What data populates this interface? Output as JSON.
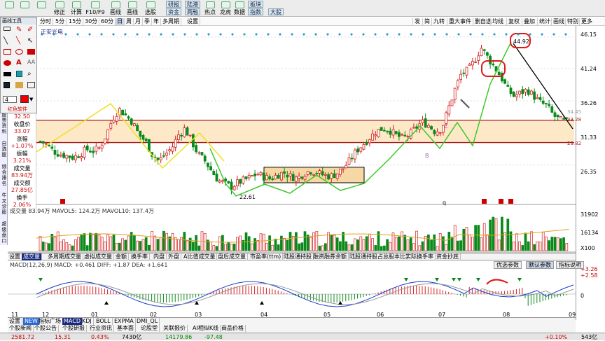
{
  "toolbar": {
    "buttons": [
      "",
      "",
      "",
      "修正",
      "计算",
      "F10/F9",
      "画线",
      "画线",
      "选股",
      "",
      "",
      ""
    ],
    "panel_buttons": [
      [
        "研报",
        "陆港"
      ],
      [
        "资金",
        "两融"
      ],
      [
        "热点",
        "龙虎"
      ],
      [
        "数据"
      ],
      [
        "板块",
        "指数"
      ],
      [
        "大股"
      ]
    ]
  },
  "periods": [
    "分时",
    "5分",
    "15分",
    "30分",
    "60分",
    "日",
    "周",
    "月",
    "季",
    "年",
    "多周期",
    "设置"
  ],
  "active_period": "日",
  "right_tools": [
    "发",
    "简",
    "九转",
    "重大事件",
    "删自选",
    "均线",
    "复权",
    "叠加",
    "统计",
    "画线",
    "特别",
    "更多"
  ],
  "drawing_panel": {
    "title": "画线工具",
    "width_value": "4",
    "red_label": "红色软件"
  },
  "stock_name": "正安光电",
  "left_info": {
    "top_value": "32.50",
    "close_label": "收盘价",
    "close": "33.07",
    "change_label": "涨幅",
    "change": "+1.07%",
    "amp_label": "振幅",
    "amp": "3.21%",
    "vol_label": "成交量",
    "vol": "83.94万",
    "amount_label": "成交额",
    "amount": "27.85亿",
    "turn_label": "换手",
    "turn": "2.06%"
  },
  "side_tabs": [
    "股票资料",
    "自选股",
    "综合排名",
    "牛叉诊股",
    "超级盘口"
  ],
  "price_axis": [
    "46.15",
    "41.24",
    "36.26",
    "31.33",
    "26.35"
  ],
  "volume_axis": [
    "31902",
    "16134",
    "X100"
  ],
  "macd_axis": [
    "+3.26",
    "+2.58",
    "0"
  ],
  "price_levels": {
    "upper": "33.28",
    "lower": "29.82",
    "mid": "34.45"
  },
  "annotations": {
    "high": "44.92",
    "low": "22.61",
    "letter_c": "C",
    "letter_b": "B",
    "letter_q": "q"
  },
  "volume_legend": "成交量 83.94万  MAVOL5: 124.2万  MAVOL10: 137.4万",
  "macd_legend": "MACD(12,26,9)  MACD: +0.461  DIFF: +1.87  DEA: +1.641",
  "chart_tabs": [
    "设置",
    "成交量",
    "多周期成交量",
    "虚拟成交量",
    "金额",
    "换手率",
    "内盘",
    "外盘",
    "A比值成交量",
    "盘后成交量",
    "市盈率(ttm)",
    "陆股通持股",
    "融资融券余额",
    "陆股通持股占总股本比",
    "实际换手率",
    "资金抄底"
  ],
  "param_buttons": [
    "优选参数",
    "默认参数",
    "指标说明"
  ],
  "x_axis": [
    "11",
    "12",
    "01",
    "02",
    "03",
    "04",
    "05",
    "06",
    "07",
    "08",
    "09"
  ],
  "indicator_tabs": [
    "设置",
    "NEW",
    "指标广场",
    "MACD",
    "KDJ",
    "BOLL",
    "EXPMA",
    "DMI_QL"
  ],
  "news_tabs": [
    "个股新闻",
    "个股公告",
    "个股研报",
    "行业资讯",
    "基本面",
    "论股堂",
    "关联报价",
    "AI相似K线",
    "商品价格"
  ],
  "status_bar": {
    "a": "2581.72",
    "b": "15.31",
    "c": "0.43%",
    "d": "7430亿",
    "e": "14179.86",
    "f": "-97.48",
    "g": "+0.10%",
    "h": "543亿"
  },
  "colors": {
    "up": "#d62020",
    "down": "#0a8a1a",
    "fill": "#fde8c8",
    "box": "#f5d8a4",
    "band": "#a51c1c"
  },
  "chart_data": {
    "type": "candlestick",
    "ylim": [
      21,
      47
    ],
    "upper_level": 33.28,
    "lower_level": 29.82,
    "high": 44.92,
    "low": 22.61,
    "x_labels": [
      "11",
      "12",
      "01",
      "02",
      "03",
      "04",
      "05",
      "06",
      "07",
      "08",
      "09"
    ],
    "close_path": [
      30,
      29.5,
      28.5,
      28,
      27.8,
      27.5,
      28,
      28.8,
      28.5,
      29,
      31,
      33.5,
      35,
      34,
      33,
      31,
      30,
      28,
      27,
      28,
      29,
      31,
      32,
      30,
      28,
      27,
      25.5,
      24,
      23.5,
      23,
      23.6,
      24,
      24.5,
      25,
      24.5,
      24.2,
      24.8,
      25.2,
      24.6,
      24.3,
      25,
      25.5,
      25.2,
      24.8,
      24.6,
      25,
      25.8,
      27,
      28.5,
      29.5,
      30.5,
      31.5,
      32,
      31.8,
      31,
      30.5,
      31,
      32,
      33,
      32.5,
      31.5,
      32,
      35,
      38,
      40.5,
      41,
      42.5,
      44.5,
      43,
      41.5,
      40,
      38,
      37,
      37.5,
      38,
      37,
      36,
      35.5,
      34,
      33.28,
      33.07
    ]
  }
}
